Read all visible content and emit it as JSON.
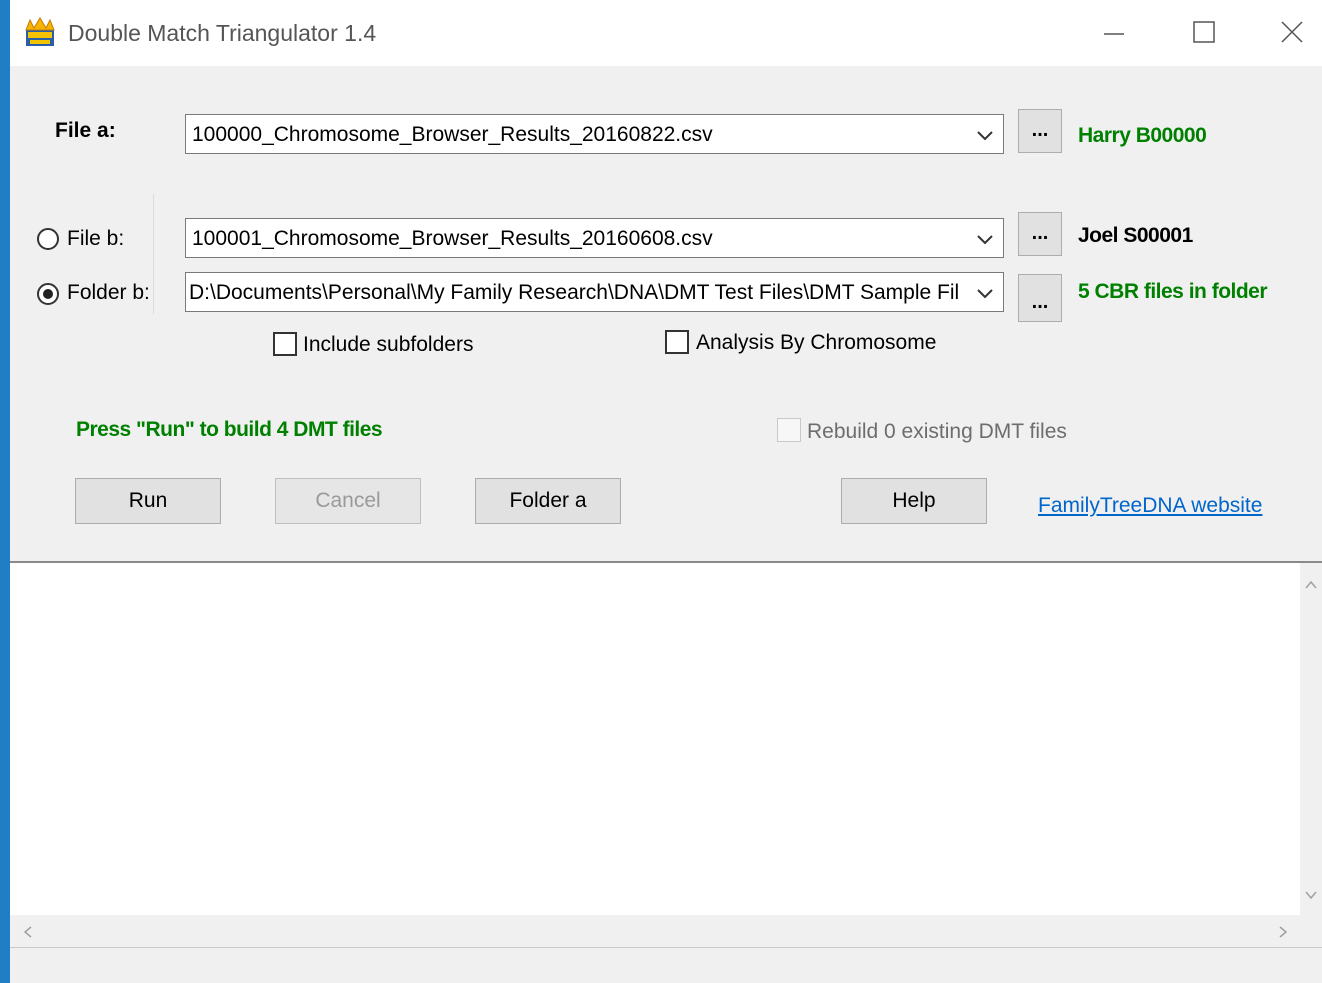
{
  "window": {
    "title": "Double Match Triangulator 1.4",
    "icon": "dmt-app-icon",
    "controls": [
      "minimize-icon",
      "maximize-icon",
      "close-icon"
    ]
  },
  "file_a": {
    "label": "File a:",
    "value": "100000_Chromosome_Browser_Results_20160822.csv",
    "browse_label": "...",
    "status": "Harry B00000"
  },
  "file_b": {
    "label": "File b:",
    "value": "100001_Chromosome_Browser_Results_20160608.csv",
    "browse_label": "...",
    "status": "Joel S00001",
    "selected": false
  },
  "folder_b": {
    "label": "Folder b:",
    "value": "D:\\Documents\\Personal\\My Family Research\\DNA\\DMT Test Files\\DMT Sample Fil",
    "browse_label": "...",
    "status": "5 CBR files in folder",
    "selected": true
  },
  "options": {
    "include_subfolders": {
      "label": "Include subfolders",
      "checked": false
    },
    "analysis_by_chromosome": {
      "label": "Analysis By Chromosome",
      "checked": false
    },
    "rebuild": {
      "label": "Rebuild 0 existing DMT files",
      "checked": false,
      "enabled": false
    }
  },
  "message": "Press \"Run\" to build 4 DMT files",
  "buttons": {
    "run": "Run",
    "cancel": "Cancel",
    "folder_a": "Folder a",
    "help": "Help"
  },
  "link": "FamilyTreeDNA website",
  "colors": {
    "status_green": "#008000",
    "link_blue": "#0066cc",
    "desktop": "#1f7ec4"
  }
}
